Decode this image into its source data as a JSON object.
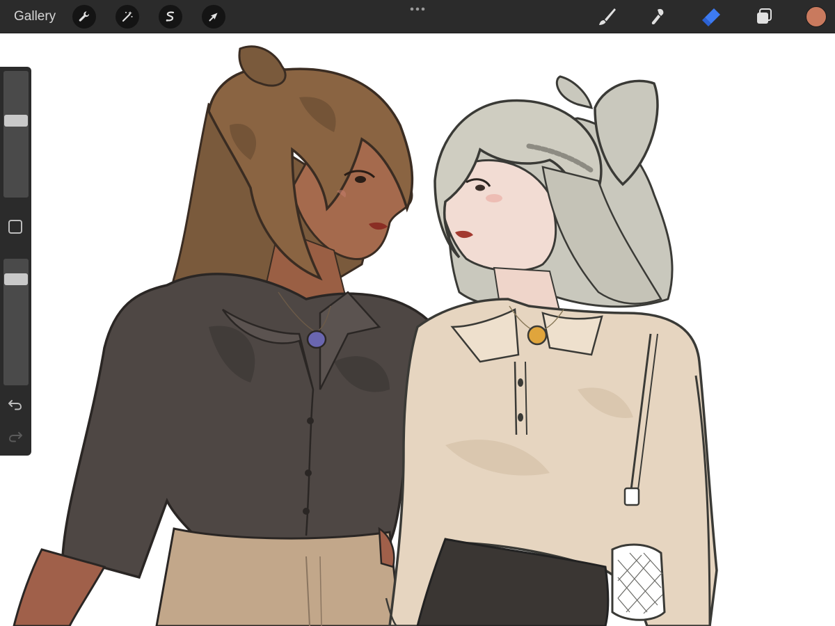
{
  "toolbar": {
    "gallery_label": "Gallery",
    "left_tools": [
      "wrench-icon",
      "magic-wand-icon",
      "selection-icon",
      "transform-arrow-icon"
    ],
    "right_tools": [
      "brush-icon",
      "smudge-icon",
      "eraser-icon",
      "layers-icon"
    ],
    "active_tool": "eraser-icon",
    "current_color": "#c97a5e"
  },
  "sidebar": {
    "brush_size_level": 0.62,
    "opacity_level": 0.87,
    "icons": [
      "square-modify-icon",
      "undo-icon",
      "redo-icon"
    ]
  },
  "colors": {
    "bar": "#2b2b2b",
    "accent": "#3d7bf2",
    "canvas": "#ffffff"
  }
}
